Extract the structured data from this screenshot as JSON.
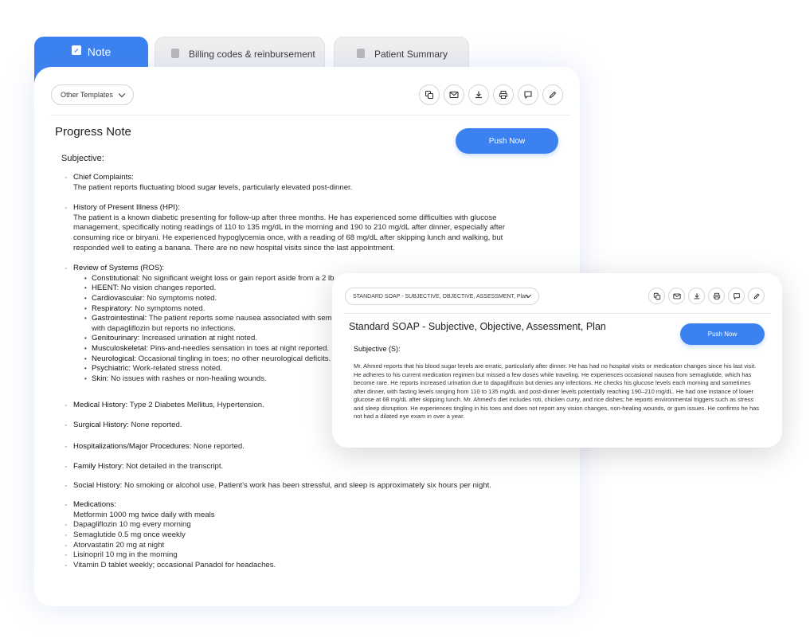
{
  "tabs": [
    {
      "label": "Note",
      "icon": "edit-note-icon"
    },
    {
      "label": "Billing codes & reinbursement",
      "icon": "clipboard-icon"
    },
    {
      "label": "Patient Summary",
      "icon": "clipboard-icon"
    }
  ],
  "main": {
    "template_select": "Other Templates",
    "title": "Progress Note",
    "push_label": "Push Now",
    "section": "Subjective:",
    "chief_complaints": {
      "label": "Chief Complaints:",
      "text": "The patient reports fluctuating blood sugar levels, particularly elevated post-dinner."
    },
    "hpi": {
      "label": "History of Present Illness (HPI):",
      "text": "The patient is a known diabetic presenting for follow-up after three months. He has experienced some difficulties with glucose management, specifically noting readings of 110 to 135 mg/dL in the morning and 190 to 210 mg/dL after dinner, especially after consuming rice or biryani. He experienced hypoglycemia once, with a reading of 68 mg/dL after skipping lunch and walking, but responded well to eating a banana. There are no new hospital visits since the last appointment."
    },
    "ros": {
      "label": "Review of Systems (ROS):",
      "items": [
        {
          "label": "Constitutional:",
          "text": " No significant weight loss or gain report aside from a 2 lb"
        },
        {
          "label": "HEENT:",
          "text": " No vision changes reported."
        },
        {
          "label": "Cardiovascular:",
          "text": " No symptoms noted."
        },
        {
          "label": "Respiratory:",
          "text": " No symptoms noted."
        },
        {
          "label": "Gastrointestinal:",
          "text": " The patient reports some nausea associated with semaglutide, which has become rare, and increased urination with dapagliflozin but reports no infections."
        },
        {
          "label": "Genitourinary:",
          "text": " Increased urination at night noted."
        },
        {
          "label": "Musculoskeletal:",
          "text": " Pins-and-needles sensation in toes at night reported."
        },
        {
          "label": "Neurological:",
          "text": " Occasional tingling in toes; no other neurological deficits."
        },
        {
          "label": "Psychiatric:",
          "text": " Work-related stress noted."
        },
        {
          "label": "Skin:",
          "text": " No issues with rashes or non-healing wounds."
        }
      ]
    },
    "medical_history": {
      "label": "Medical History:",
      "text": " Type 2 Diabetes Mellitus, Hypertension."
    },
    "surgical_history": {
      "label": "Surgical History:",
      "text": " None reported."
    },
    "hospitalizations": {
      "label": "Hospitalizations/Major Procedures:",
      "text": " None reported."
    },
    "family_history": {
      "label": "Family History:",
      "text": " Not detailed in the transcript."
    },
    "social_history": {
      "label": "Social History:",
      "text": " No smoking or alcohol use. Patient's work has been stressful, and sleep is approximately six hours per night."
    },
    "medications": {
      "label": "Medications:",
      "first": "Metformin 1000 mg twice daily with meals",
      "items": [
        "Dapagliflozin 10 mg every morning",
        "Semaglutide 0.5 mg once weekly",
        "Atorvastatin 20 mg at night",
        "Lisinopril 10 mg in the morning",
        "Vitamin D tablet weekly; occasional Panadol for headaches."
      ]
    }
  },
  "overlay": {
    "template_select": "STANDARD SOAP - SUBJECTIVE, OBJECTIVE, ASSESSMENT, Plan",
    "title": "Standard SOAP - Subjective, Objective, Assessment, Plan",
    "push_label": "Push Now",
    "section": "Subjective (S):",
    "text": "Mr. Ahmed reports that his blood sugar levels are erratic, particularly after dinner. He has had no hospital visits or medication changes since his last visit. He adheres to his current medication regimen but missed a few doses while traveling. He experiences occasional nausea from semaglutide, which has become rare. He reports increased urination due to dapagliflozin but denies any infections. He checks his glucose levels each morning and sometimes after dinner, with fasting levels ranging from 110 to 135 mg/dL and post-dinner levels potentially reaching 190–210 mg/dL. He had one instance of lower glucose at 68 mg/dL after skipping lunch. Mr. Ahmed's diet includes roti, chicken curry, and rice dishes; he reports environmental triggers such as stress and sleep disruption. He experiences tingling in his toes and does not report any vision changes, non-healing wounds, or gum issues. He confirms he has not had a dilated eye exam in over a year."
  },
  "toolbar_icons": [
    "copy-icon",
    "mail-icon",
    "download-icon",
    "print-icon",
    "comment-icon",
    "edit-icon"
  ],
  "colors": {
    "accent": "#3b82f0",
    "tab_inactive": "#efefef"
  }
}
